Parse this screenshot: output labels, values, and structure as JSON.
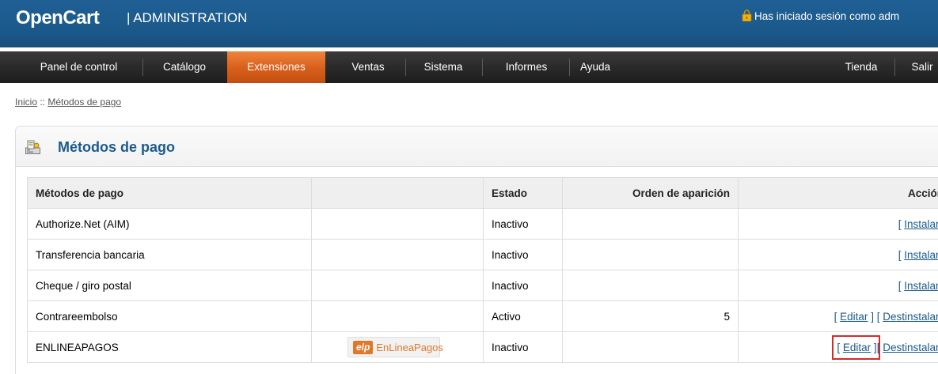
{
  "header": {
    "logo": "OpenCart",
    "logo_sub": "| ADMINISTRATION",
    "login_text": "Has iniciado sesión como adm",
    "lock_icon": "lock-icon"
  },
  "menu": {
    "items": [
      {
        "label": "Panel de control"
      },
      {
        "label": "Catálogo"
      },
      {
        "label": "Extensiones",
        "active": true
      },
      {
        "label": "Ventas"
      },
      {
        "label": "Sistema"
      },
      {
        "label": "Informes"
      },
      {
        "label": "Ayuda"
      },
      {
        "label": "Tienda"
      },
      {
        "label": "Salir"
      }
    ],
    "active_color": "#d9611c"
  },
  "breadcrumb": {
    "home": "Inicio",
    "separator": " :: ",
    "current": "Métodos de pago"
  },
  "box": {
    "title": "Métodos de pago",
    "icon": "payment-icon"
  },
  "table": {
    "headers": [
      "Métodos de pago",
      "",
      "Estado",
      "Orden de aparición",
      "Acción"
    ],
    "rows": [
      {
        "name": "Authorize.Net (AIM)",
        "logo": "",
        "status": "Inactivo",
        "order": "",
        "actions": [
          {
            "label": "Instalar"
          }
        ]
      },
      {
        "name": "Transferencia bancaria",
        "logo": "",
        "status": "Inactivo",
        "order": "",
        "actions": [
          {
            "label": "Instalar"
          }
        ]
      },
      {
        "name": "Cheque / giro postal",
        "logo": "",
        "status": "Inactivo",
        "order": "",
        "actions": [
          {
            "label": "Instalar"
          }
        ]
      },
      {
        "name": "Contrareembolso",
        "logo": "",
        "status": "Activo",
        "order": "5",
        "actions": [
          {
            "label": "Editar"
          },
          {
            "label": "Destinstalar"
          }
        ]
      },
      {
        "name": "ENLINEAPAGOS",
        "logo_short": "elp",
        "logo_brand": "EnLineaPagos",
        "status": "Inactivo",
        "order": "",
        "actions": [
          {
            "label": "Editar",
            "highlighted": true
          },
          {
            "label": "Destinstalar"
          }
        ]
      }
    ]
  },
  "colors": {
    "header_blue": "#1c5a8c",
    "link_blue": "#1c5a8c",
    "highlight_red": "#d22b2b",
    "brand_orange": "#e0782a"
  }
}
